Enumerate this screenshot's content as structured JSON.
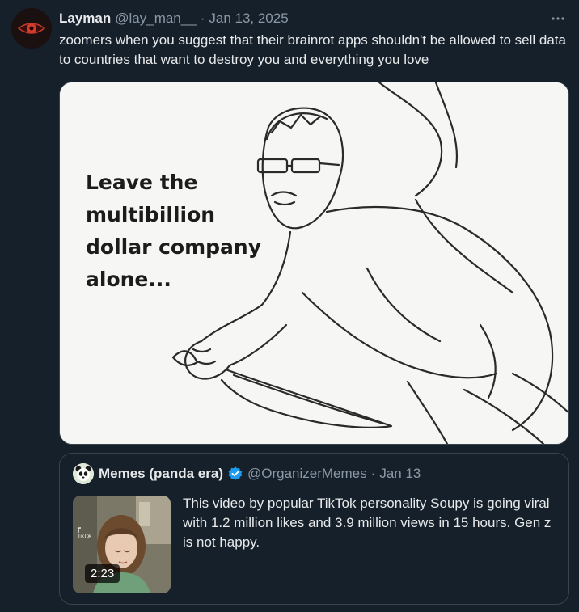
{
  "tweet": {
    "author_name": "Layman",
    "handle": "@lay_man__",
    "separator": "·",
    "date": "Jan 13, 2025",
    "more_icon": "more-horizontal-icon",
    "text": "zoomers when you suggest that their brainrot apps shouldn't be allowed to sell data to countries that want to destroy you and everything you love",
    "media": {
      "caption_lines": [
        "Leave the",
        "multibillion",
        "dollar company",
        "alone..."
      ]
    }
  },
  "quote": {
    "author_name": "Memes (panda era)",
    "verified_icon": "verified-badge-icon",
    "handle": "@OrganizerMemes",
    "separator": "·",
    "date": "Jan 13",
    "text": "This video by popular TikTok personality Soupy is going viral with 1.2 million likes and 3.9 million views in 15 hours. Gen z is not happy.",
    "video_duration": "2:23"
  },
  "colors": {
    "background": "#15202b",
    "text": "#e7e9ea",
    "secondary": "#8b98a5",
    "border": "#38444d",
    "verified": "#1d9bf0"
  }
}
